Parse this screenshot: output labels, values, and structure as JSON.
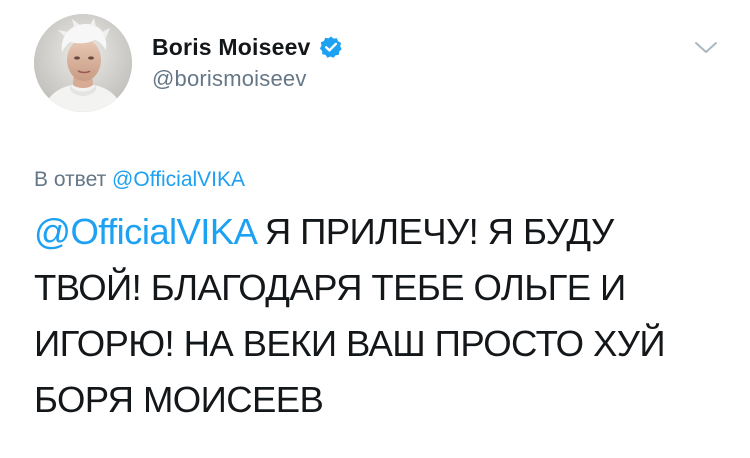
{
  "author": {
    "display_name": "Boris Moiseev",
    "handle": "@borismoiseev",
    "verified": true
  },
  "reply_context": {
    "prefix": "В ответ",
    "mention": "@OfficialVIKA"
  },
  "tweet": {
    "mention": "@OfficialVIKA",
    "line1_rest": " Я ПРИЛЕЧУ! Я БУДУ",
    "line2": "ТВОЙ! БЛАГОДАРЯ ТЕБЕ ОЛЬГЕ И",
    "line3": "ИГОРЮ! НА ВЕКИ ВАШ ПРОСТО ХУЙ",
    "line4": "БОРЯ МОИСЕЕВ"
  },
  "icons": {
    "verified": "verified-badge-icon",
    "menu": "chevron-down-icon"
  },
  "colors": {
    "link": "#1da1f2",
    "secondary_text": "#657786",
    "primary_text": "#14171a",
    "caret": "#aab8c2"
  }
}
